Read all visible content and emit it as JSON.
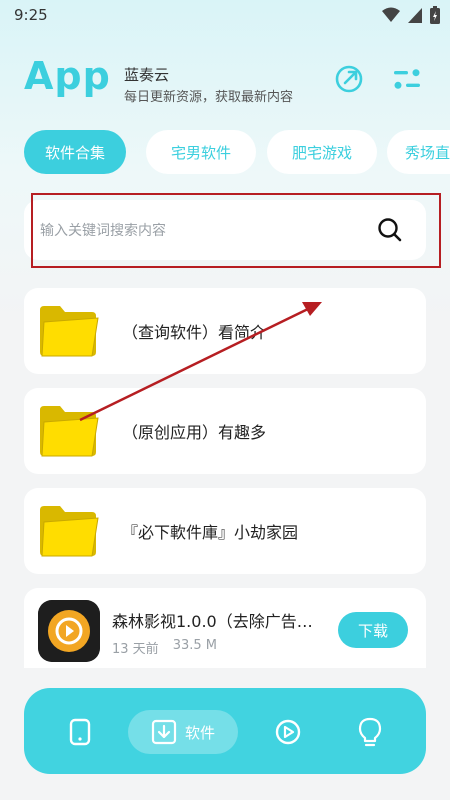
{
  "status": {
    "time": "9:25"
  },
  "header": {
    "logo": "App",
    "name": "蓝奏云",
    "subtitle": "每日更新资源，获取最新内容",
    "icons": [
      "share-icon",
      "settings-icon"
    ]
  },
  "tabs": [
    {
      "label": "软件合集",
      "active": true
    },
    {
      "label": "宅男软件",
      "active": false
    },
    {
      "label": "肥宅游戏",
      "active": false
    },
    {
      "label": "秀场直",
      "active": false
    }
  ],
  "search": {
    "placeholder": "输入关键词搜索内容"
  },
  "folders": [
    {
      "label": "（查询软件）看简介"
    },
    {
      "label": "（原创应用）有趣多"
    },
    {
      "label": "『必下軟件庫』小劫家园"
    }
  ],
  "app_item": {
    "title": "森林影视1.0.0（去除广告…",
    "time": "13 天前",
    "size": "33.5 M",
    "download_label": "下载"
  },
  "bottom_nav": {
    "items": [
      "phone-icon",
      "download-icon",
      "play-icon",
      "bulb-icon"
    ],
    "active_label": "软件"
  },
  "colors": {
    "accent": "#3ccfde",
    "annotation": "#b61e22"
  }
}
